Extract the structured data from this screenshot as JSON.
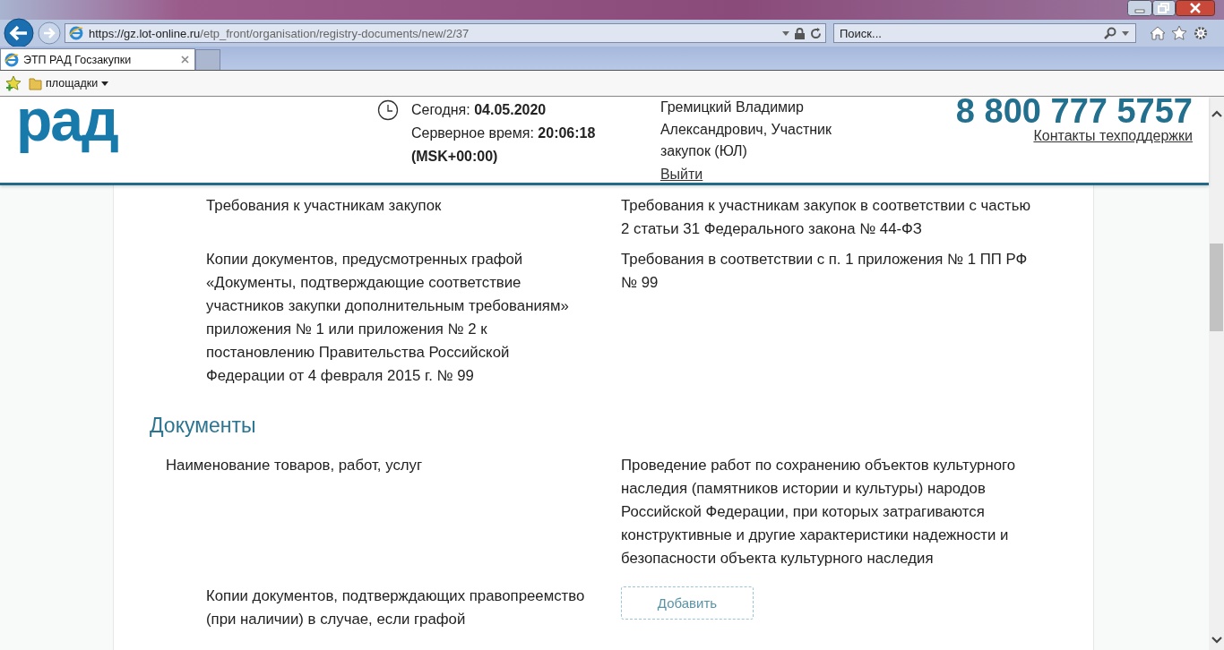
{
  "browser": {
    "address": {
      "host_prefix": "https://gz.",
      "host": "lot-online.ru",
      "path": "/etp_front/organisation/registry-documents/new/2/37"
    },
    "search": {
      "placeholder": "Поиск..."
    },
    "tabs": [
      {
        "label": "ЭТП РАД Госзакупки",
        "selected": true
      }
    ],
    "favorites": [
      {
        "label": "площадки"
      }
    ]
  },
  "header": {
    "logo": "рад",
    "today_label": "Сегодня:",
    "today_value": "04.05.2020",
    "server_time_label": "Серверное время:",
    "server_time_value": "20:06:18",
    "timezone": "(MSK+00:00)",
    "user": "Гремицкий Владимир Александрович, Участник закупок (ЮЛ)",
    "logout": "Выйти",
    "phone": "8 800 777 5757",
    "support_link": "Контакты техподдержки"
  },
  "requirements": [
    {
      "label": "Требования к участникам закупок",
      "value": "Требования к участникам закупок в соответствии с частью 2 статьи 31 Федерального закона № 44-ФЗ"
    },
    {
      "label": "Копии документов, предусмотренных графой «Документы, подтверждающие соответствие участников закупки дополнительным требованиям» приложения № 1 или приложения № 2 к постановлению Правительства Российской Федерации от 4 февраля 2015 г. № 99",
      "value": "Требования в соответствии с п. 1 приложения № 1 ПП РФ № 99"
    }
  ],
  "documents": {
    "title": "Документы",
    "rows": [
      {
        "kind": "text",
        "label": "Наименование товаров, работ, услуг",
        "value": "Проведение работ по сохранению объектов культурного наследия (памятников истории и культуры) народов Российской Федерации, при которых затрагиваются конструктивные и другие характеристики надежности и безопасности объекта культурного наследия"
      },
      {
        "kind": "upload",
        "label": "Копии документов, подтверждающих правопреемство (при наличии) в случае, если графой",
        "button": "Добавить"
      }
    ]
  }
}
